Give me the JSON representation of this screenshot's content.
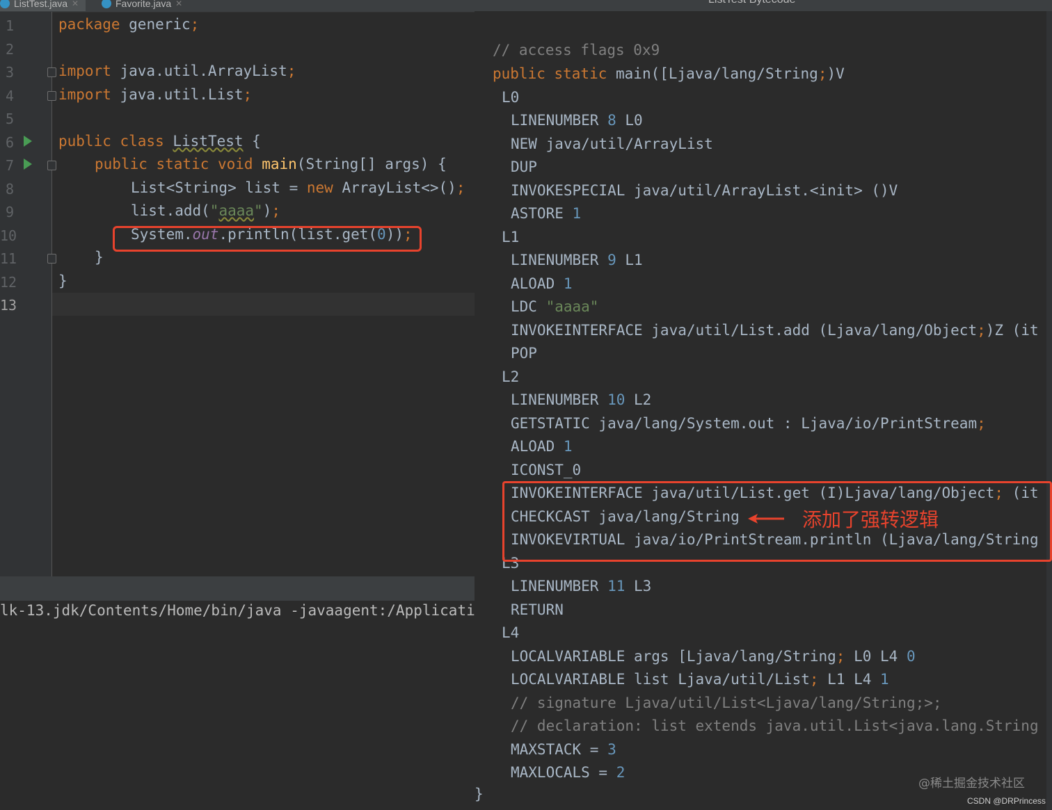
{
  "tabs": [
    {
      "label": "ListTest.java",
      "active": true
    },
    {
      "label": "Favorite.java",
      "active": false
    }
  ],
  "bytecode_title": "ListTest Bytecode",
  "gutter": {
    "line_numbers": [
      "1",
      "2",
      "3",
      "4",
      "5",
      "6",
      "7",
      "8",
      "9",
      "10",
      "11",
      "12",
      "13"
    ],
    "current_line": "13"
  },
  "editor": {
    "l1": {
      "kw": "package",
      "rest": " generic",
      "semi": ";"
    },
    "l3": {
      "kw": "import",
      "rest": " java.util.ArrayList",
      "semi": ";"
    },
    "l4": {
      "kw": "import",
      "rest": " java.util.List",
      "semi": ";"
    },
    "l6": {
      "kw": "public class ",
      "name": "ListTest",
      "rest": " {"
    },
    "l7": {
      "kw": "public static void ",
      "fn": "main",
      "rest": "(String[] args) {"
    },
    "l8": {
      "a": "List<String> list = ",
      "kw": "new",
      "b": " ArrayList<>()",
      "semi": ";"
    },
    "l9": {
      "a": "list.add(",
      "str_open": "\"",
      "str": "aaaa",
      "str_close": "\"",
      "b": ")",
      "semi": ";"
    },
    "l10": {
      "a": "System.",
      "fld": "out",
      "b": ".println(list.get(",
      "num": "0",
      "c": "))",
      "semi": ";"
    },
    "l11": {
      "a": "}"
    },
    "l12": {
      "a": "}"
    }
  },
  "terminal": {
    "line": "lk-13.jdk/Contents/Home/bin/java -javaagent:/Applicati"
  },
  "bytecode": {
    "comment_flags": "// access flags 0x9",
    "sig_kw": "public static ",
    "sig_rest": "main([Ljava/lang/String",
    "sig_semi": ";",
    "sig_end": ")V",
    "L0": "L0",
    "ln8_a": "LINENUMBER ",
    "ln8_n": "8",
    "ln8_b": " L0",
    "new": "NEW java/util/ArrayList",
    "dup": "DUP",
    "invokespecial": "INVOKESPECIAL java/util/ArrayList.<init> ()V",
    "astore_a": "ASTORE ",
    "astore_n": "1",
    "L1": "L1",
    "ln9_a": "LINENUMBER ",
    "ln9_n": "9",
    "ln9_b": " L1",
    "aload1_a": "ALOAD ",
    "aload1_n": "1",
    "ldc_a": "LDC ",
    "ldc_s": "\"aaaa\"",
    "ii_add_a": "INVOKEINTERFACE java/util/List.add (Ljava/lang/Object",
    "ii_add_semi": ";",
    "ii_add_b": ")Z (it",
    "pop": "POP",
    "L2": "L2",
    "ln10_a": "LINENUMBER ",
    "ln10_n": "10",
    "ln10_b": " L2",
    "getstatic_a": "GETSTATIC java/lang/System.out : Ljava/io/PrintStream",
    "getstatic_semi": ";",
    "aload2_a": "ALOAD ",
    "aload2_n": "1",
    "iconst": "ICONST_0",
    "ii_get_a": "INVOKEINTERFACE java/util/List.get (I)Ljava/lang/Object",
    "ii_get_semi": ";",
    "ii_get_b": " (it",
    "checkcast": "CHECKCAST java/lang/String",
    "invokevirtual": "INVOKEVIRTUAL java/io/PrintStream.println (Ljava/lang/String",
    "L3": "L3",
    "ln11_a": "LINENUMBER ",
    "ln11_n": "11",
    "ln11_b": " L3",
    "return": "RETURN",
    "L4": "L4",
    "lv1_a": "LOCALVARIABLE args [Ljava/lang/String",
    "lv1_semi": ";",
    "lv1_b": " L0 L4 ",
    "lv1_n": "0",
    "lv2_a": "LOCALVARIABLE list Ljava/util/List",
    "lv2_semi": ";",
    "lv2_b": " L1 L4 ",
    "lv2_n": "1",
    "comment_sig": "// signature Ljava/util/List<Ljava/lang/String;>;",
    "comment_decl": "// declaration: list extends java.util.List<java.lang.String",
    "maxstack_a": "MAXSTACK = ",
    "maxstack_n": "3",
    "maxlocals_a": "MAXLOCALS = ",
    "maxlocals_n": "2",
    "closing": "}"
  },
  "annotation": {
    "note": "添加了强转逻辑",
    "color": "#e8432d"
  },
  "watermark": {
    "line1": "@稀土掘金技术社区",
    "line2": "CSDN @DRPrincess"
  },
  "colors": {
    "background": "#2b2b2b",
    "keyword": "#cc7832",
    "string": "#6a8759",
    "number": "#6897bb",
    "field": "#9876aa",
    "method": "#ffc66d",
    "text": "#a9b7c6",
    "comment": "#808080"
  }
}
